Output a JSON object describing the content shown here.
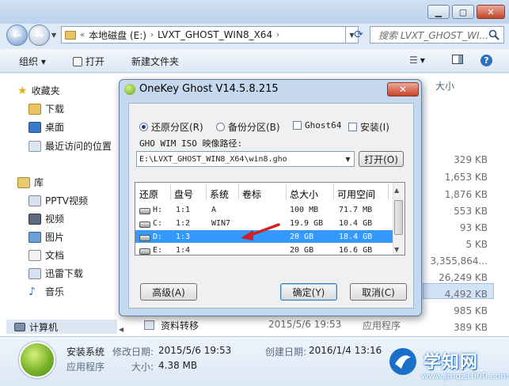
{
  "explorer": {
    "address": {
      "back_symbol": "«",
      "crumbs": [
        "本地磁盘 (E:)",
        "LVXT_GHOST_WIN8_X64"
      ],
      "sep": "›"
    },
    "search_placeholder": "搜索 LVXT_GHOST_WI...",
    "toolbar": {
      "organize": "组织 ▾",
      "open": "打开",
      "new_folder": "新建文件夹"
    },
    "sidebar": {
      "favorites": "收藏夹",
      "fav_items": [
        "下载",
        "桌面",
        "最近访问的位置"
      ],
      "libraries": "库",
      "lib_items": [
        "PPTV视频",
        "视频",
        "图片",
        "文档",
        "迅雷下载",
        "音乐"
      ],
      "computer": "计算机"
    },
    "size_header": "大小",
    "sizes": [
      "329 KB",
      "1,653 KB",
      "1,876 KB",
      "553 KB",
      "93 KB",
      "5 KB",
      "3,355,864...",
      "26,249 KB",
      "4,492 KB",
      "985 KB",
      "389 KB"
    ],
    "last_row": {
      "name": "资料转移",
      "date": "2015/5/6 19:53",
      "type": "应用程序"
    },
    "details": {
      "name": "安装系统",
      "modified_label": "修改日期:",
      "modified": "2015/5/6 19:53",
      "created_label": "创建日期:",
      "created": "2016/1/4 13:16",
      "type": "应用程序",
      "size_label": "大小:",
      "size": "4.38 MB"
    }
  },
  "dialog": {
    "title": "OneKey Ghost V14.5.8.215",
    "close": "✕",
    "options": {
      "restore": "还原分区(R)",
      "backup": "备份分区(B)",
      "ghost64": "Ghost64",
      "install": "安装(I)",
      "selected": "restore"
    },
    "path_label": "GHO WIM ISO 映像路径:",
    "path_value": "E:\\LVXT_GHOST_WIN8_X64\\win8.gho",
    "open_button": "打开(O)",
    "table": {
      "headers": [
        "还原",
        "盘号",
        "系统",
        "卷标",
        "总大小",
        "可用空间"
      ],
      "rows": [
        {
          "drive": "H:",
          "disk": "1:1",
          "system": "A",
          "label": "",
          "total": "100 MB",
          "free": "71.7 MB"
        },
        {
          "drive": "C:",
          "disk": "1:2",
          "system": "WIN7",
          "label": "",
          "total": "19.9 GB",
          "free": "10.4 GB"
        },
        {
          "drive": "D:",
          "disk": "1:3",
          "system": "",
          "label": "",
          "total": "20 GB",
          "free": "18.4 GB"
        },
        {
          "drive": "E:",
          "disk": "1:4",
          "system": "",
          "label": "",
          "total": "20 GB",
          "free": "16.6 GB"
        }
      ],
      "selected_row": 2
    },
    "buttons": {
      "advanced": "高级(A)",
      "ok": "确定(Y)",
      "cancel": "取消(C)"
    }
  },
  "watermark": {
    "title": "学知网",
    "url": "www.jmqz1000.com"
  },
  "colors": {
    "selection": "#3399ff",
    "arrow": "#d21f1f",
    "dialog_frame": "#c5d8ee"
  }
}
